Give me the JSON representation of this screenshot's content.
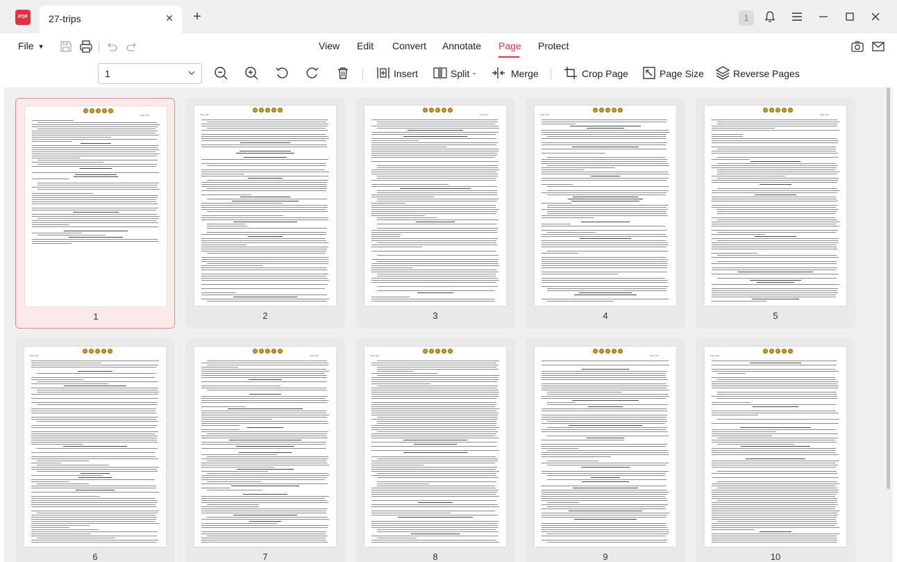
{
  "app": {
    "logo_text": "PDF",
    "tab_title": "27-trips",
    "notification_count": "1",
    "accent_color": "#e3313f"
  },
  "menubar": {
    "file_label": "File",
    "nav": [
      {
        "label": "View"
      },
      {
        "label": "Edit"
      },
      {
        "label": "Convert"
      },
      {
        "label": "Annotate"
      },
      {
        "label": "Page",
        "active": true
      },
      {
        "label": "Protect"
      }
    ]
  },
  "toolbar": {
    "page_select_value": "1",
    "insert_label": "Insert",
    "split_label": "Split",
    "merge_label": "Merge",
    "crop_label": "Crop Page",
    "page_size_label": "Page Size",
    "reverse_label": "Reverse Pages"
  },
  "thumbnails": [
    {
      "number": "1",
      "selected": true,
      "page_label": "Page 319"
    },
    {
      "number": "2",
      "page_label": "Page 320"
    },
    {
      "number": "3",
      "page_label": "Page 321"
    },
    {
      "number": "4",
      "page_label": "Page 322"
    },
    {
      "number": "5",
      "page_label": "Page 323"
    },
    {
      "number": "6",
      "page_label": "Page 324"
    },
    {
      "number": "7",
      "page_label": "Page 325"
    },
    {
      "number": "8",
      "page_label": "Page 326"
    },
    {
      "number": "9",
      "page_label": "Page 327"
    },
    {
      "number": "10",
      "page_label": "Page 328"
    }
  ],
  "icons": [
    "pdf-logo-icon",
    "close-icon",
    "plus-icon",
    "bell-icon",
    "hamburger-icon",
    "minimize-icon",
    "maximize-icon",
    "close-window-icon",
    "save-icon",
    "print-icon",
    "undo-icon",
    "redo-icon",
    "camera-icon",
    "mail-icon",
    "zoom-out-icon",
    "zoom-in-icon",
    "rotate-left-icon",
    "rotate-right-icon",
    "trash-icon",
    "insert-icon",
    "split-icon",
    "merge-icon",
    "crop-icon",
    "page-size-icon",
    "reverse-pages-icon"
  ]
}
